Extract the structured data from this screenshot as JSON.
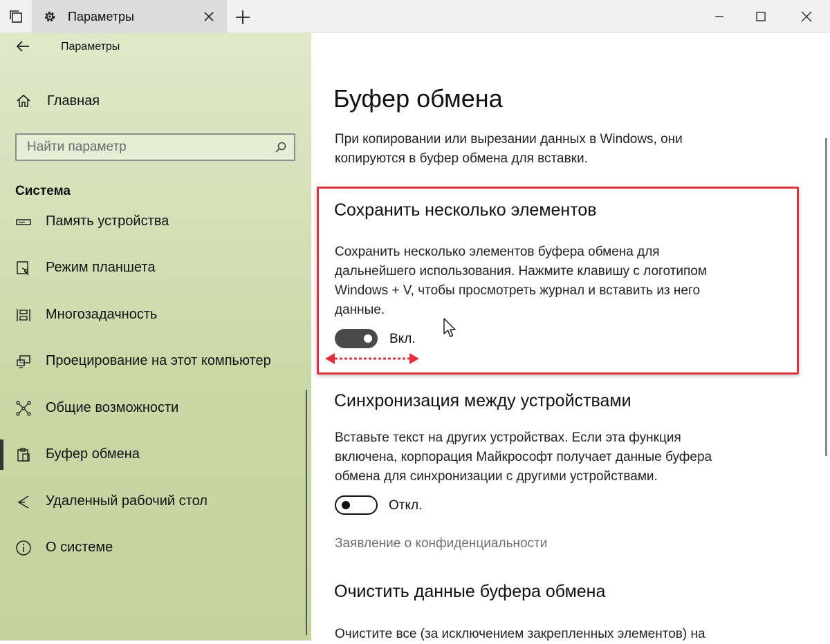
{
  "window": {
    "tab_title": "Параметры",
    "sidebar_header": "Параметры"
  },
  "sidebar": {
    "home_label": "Главная",
    "search_placeholder": "Найти параметр",
    "section_label": "Система",
    "items": [
      {
        "label": "Память устройства",
        "icon": "storage-icon"
      },
      {
        "label": "Режим планшета",
        "icon": "tablet-mode-icon"
      },
      {
        "label": "Многозадачность",
        "icon": "multitasking-icon"
      },
      {
        "label": "Проецирование на этот компьютер",
        "icon": "projecting-icon"
      },
      {
        "label": "Общие возможности",
        "icon": "shared-experiences-icon"
      },
      {
        "label": "Буфер обмена",
        "icon": "clipboard-icon",
        "active": true
      },
      {
        "label": "Удаленный рабочий стол",
        "icon": "remote-desktop-icon"
      },
      {
        "label": "О системе",
        "icon": "info-icon"
      }
    ]
  },
  "main": {
    "title": "Буфер обмена",
    "intro_line1": "При копировании или вырезании данных в Windows, они",
    "intro_line2": "копируются в буфер обмена для вставки.",
    "history": {
      "title": "Сохранить несколько элементов",
      "desc_line1": "Сохранить несколько элементов буфера обмена для",
      "desc_line2": "дальнейшего использования. Нажмите клавишу с логотипом",
      "desc_line3": "Windows + V, чтобы просмотреть журнал и вставить из него",
      "desc_line4": "данные.",
      "toggle_state": "on",
      "toggle_label": "Вкл."
    },
    "sync": {
      "title": "Синхронизация между устройствами",
      "desc_line1": "Вставьте текст на других устройствах. Если эта функция",
      "desc_line2": "включена, корпорация Майкрософт получает данные буфера",
      "desc_line3": "обмена для синхронизации с другими устройствами.",
      "toggle_state": "off",
      "toggle_label": "Откл."
    },
    "privacy_link": "Заявление о конфиденциальности",
    "clear": {
      "title": "Очистить данные буфера обмена",
      "desc_line1": "Очистите все (за исключением закрепленных элементов) на"
    }
  },
  "colors": {
    "highlight_border": "#e0323c",
    "toggle_on": "#4a4a4a",
    "sidebar_bg": "#d2dfb4"
  }
}
